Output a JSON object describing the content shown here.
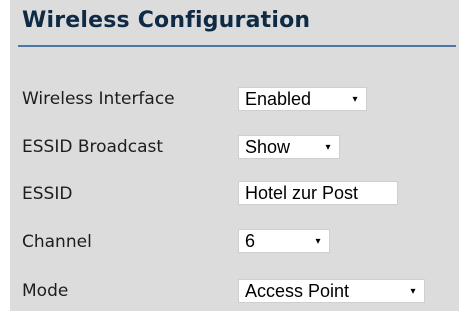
{
  "header": {
    "title": "Wireless Configuration"
  },
  "form": {
    "wireless_interface": {
      "label": "Wireless Interface",
      "value": "Enabled"
    },
    "essid_broadcast": {
      "label": "ESSID Broadcast",
      "value": "Show"
    },
    "essid": {
      "label": "ESSID",
      "value": "Hotel zur Post"
    },
    "channel": {
      "label": "Channel",
      "value": "6"
    },
    "mode": {
      "label": "Mode",
      "value": "Access Point"
    }
  },
  "icons": {
    "dropdown": "chevron-down-icon"
  },
  "colors": {
    "panel_bg": "#dcdcdc",
    "title": "#0f2a44",
    "rule": "#4a77a4"
  }
}
